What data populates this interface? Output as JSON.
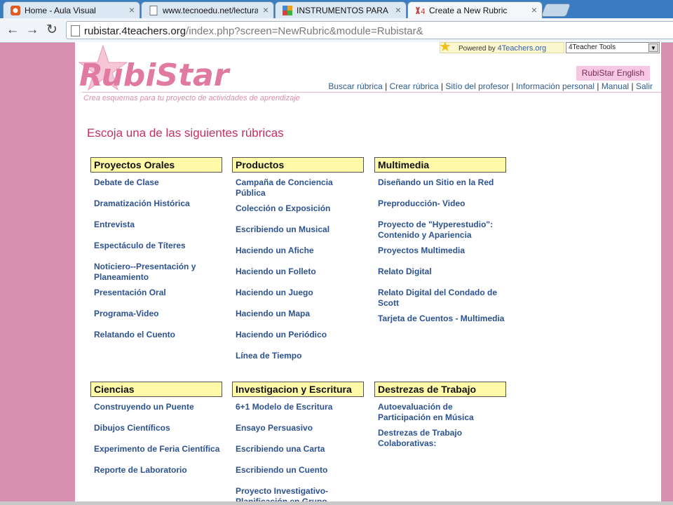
{
  "browser": {
    "tabs": [
      {
        "title": "Home - Aula Visual",
        "active": false
      },
      {
        "title": "www.tecnoedu.net/lectura",
        "active": false
      },
      {
        "title": "INSTRUMENTOS PARA LE",
        "active": false
      },
      {
        "title": "Create a New Rubric",
        "active": true
      }
    ],
    "url_host": "rubistar.4teachers.org",
    "url_path": "/index.php?screen=NewRubric&module=Rubistar&"
  },
  "header": {
    "logo_text": "RubiStar",
    "tagline": "Crea esquemas para tu proyecto de actividades de aprendizaje",
    "powered_label": "Powered by",
    "powered_brand": "4Teachers.org",
    "tools_select_value": "4Teacher Tools",
    "language_button": "RubiStar English",
    "nav": {
      "items": [
        "Buscar rúbrica",
        "Crear rúbrica",
        "Sitío del profesor",
        "Información personal",
        "Manual",
        "Salir"
      ],
      "separator": "|"
    }
  },
  "main": {
    "title": "Escoja una de las siguientes rúbricas",
    "categories": [
      {
        "name": "Proyectos Orales",
        "links": [
          "Debate de Clase",
          "Dramatización Histórica",
          "Entrevista",
          "Espectáculo de Títeres",
          "Noticiero--Presentación y Planeamiento",
          "Presentación Oral",
          "Programa-Video",
          "Relatando el Cuento"
        ]
      },
      {
        "name": "Productos",
        "links": [
          "Campaña de Conciencia Pública",
          "Colección o Exposición",
          "Escribiendo un Musical",
          "Haciendo un Afiche",
          "Haciendo un Folleto",
          "Haciendo un Juego",
          "Haciendo un Mapa",
          "Haciendo un Periódico",
          "Línea de Tiempo"
        ]
      },
      {
        "name": "Multimedia",
        "links": [
          "Diseñando un Sitio en la Red",
          "Preproducción- Video",
          "Proyecto de \"Hyperestudio\": Contenido y Apariencia",
          "Proyectos Multimedia",
          "Relato Digital",
          "Relato Digital del Condado de Scott",
          "Tarjeta de Cuentos - Multimedia"
        ]
      },
      {
        "name": "Ciencias",
        "links": [
          "Construyendo un Puente",
          "Dibujos Científicos",
          "Experimento de Feria Científica",
          "Reporte de Laboratorio"
        ]
      },
      {
        "name": "Investigacion y Escritura",
        "links": [
          "6+1 Modelo de Escritura",
          "Ensayo Persuasivo",
          "Escribiendo una Carta",
          "Escribiendo un Cuento",
          "Proyecto Investigativo- Planificación en Grupo"
        ]
      },
      {
        "name": "Destrezas de Trabajo",
        "links": [
          "Autoevaluación de Participación en Música",
          "Destrezas de Trabajo Colaborativas:"
        ]
      }
    ]
  },
  "colors": {
    "background": "#d88fb0",
    "category_header": "#fff9a8",
    "link": "#2c5290",
    "title": "#c43060",
    "tab_strip": "#3a7cc1"
  }
}
